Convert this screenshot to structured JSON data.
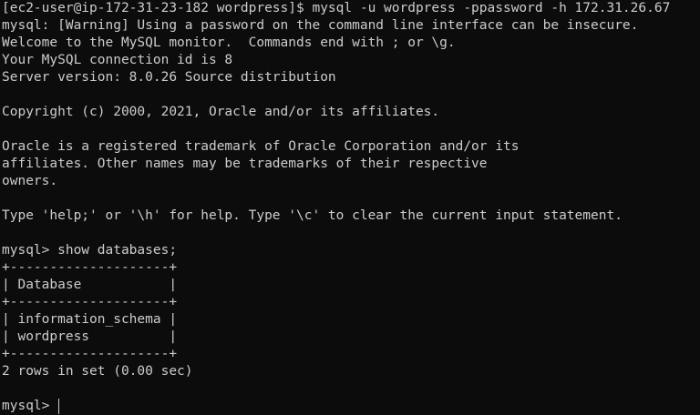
{
  "terminal": {
    "lines": [
      "[ec2-user@ip-172-31-23-182 wordpress]$ mysql -u wordpress -ppassword -h 172.31.26.67",
      "mysql: [Warning] Using a password on the command line interface can be insecure.",
      "Welcome to the MySQL monitor.  Commands end with ; or \\g.",
      "Your MySQL connection id is 8",
      "Server version: 8.0.26 Source distribution",
      "",
      "Copyright (c) 2000, 2021, Oracle and/or its affiliates.",
      "",
      "Oracle is a registered trademark of Oracle Corporation and/or its",
      "affiliates. Other names may be trademarks of their respective",
      "owners.",
      "",
      "Type 'help;' or '\\h' for help. Type '\\c' to clear the current input statement.",
      "",
      "mysql> show databases;",
      "+--------------------+",
      "| Database           |",
      "+--------------------+",
      "| information_schema |",
      "| wordpress          |",
      "+--------------------+",
      "2 rows in set (0.00 sec)",
      ""
    ],
    "current_prompt": "mysql> "
  }
}
